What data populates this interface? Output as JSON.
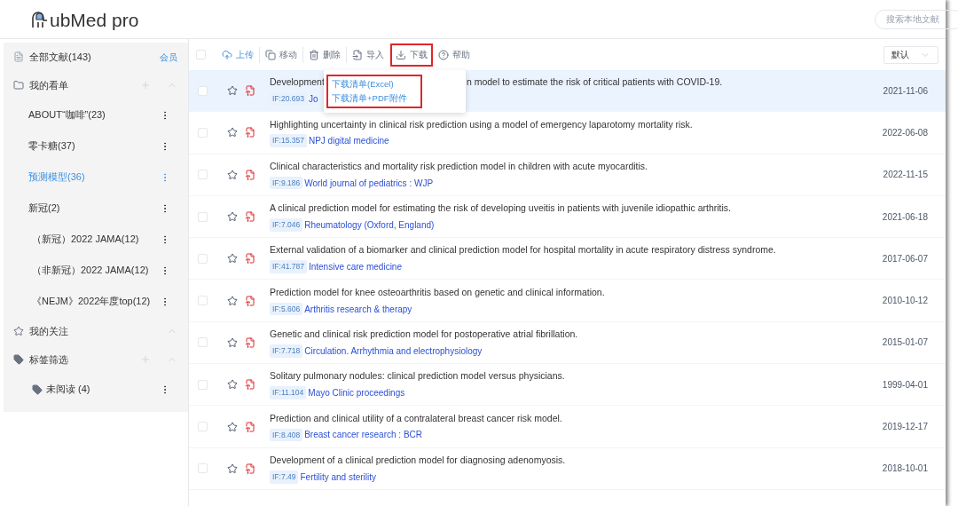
{
  "header": {
    "logo": "ubMed pro",
    "search": {
      "placeholder": "搜索本地文献"
    }
  },
  "sidebar": [
    {
      "kind": "all",
      "label": "全部文献(143)",
      "badge": "会员"
    },
    {
      "kind": "folder",
      "label": "我的看单",
      "add": true,
      "expanded": true,
      "children": [
        {
          "label": "ABOUT“咖啡”(23)",
          "selected": false
        },
        {
          "label": "零卡糖(37)",
          "selected": false
        },
        {
          "label": "预测模型(36)",
          "selected": true
        },
        {
          "label": "新冠(2)",
          "selected": false,
          "children": [
            {
              "label": "（新冠）2022 JAMA(12)",
              "selected": false
            },
            {
              "label": "（非新冠）2022 JAMA(12)",
              "selected": false
            },
            {
              "label": "《NEJM》2022年度top(12)",
              "selected": false
            }
          ]
        }
      ]
    },
    {
      "kind": "star",
      "label": "我的关注",
      "add": false,
      "expanded": true
    },
    {
      "kind": "tag",
      "label": "标签筛选",
      "add": true,
      "expanded": true,
      "children": [
        {
          "label": "未阅读 (4)",
          "selected": false,
          "kind": "tag"
        }
      ]
    }
  ],
  "toolbar": {
    "select_all": {
      "checked": false
    },
    "items": [
      {
        "kind": "upload",
        "label": "上传",
        "highlighted": false
      },
      {
        "kind": "move",
        "label": "移动",
        "highlighted": false
      },
      {
        "kind": "delete",
        "label": "删除",
        "highlighted": false
      },
      {
        "kind": "import",
        "label": "导入",
        "highlighted": false
      },
      {
        "kind": "download",
        "label": "下载",
        "highlighted": true
      },
      {
        "kind": "help",
        "label": "帮助",
        "highlighted": false
      }
    ],
    "sort": "默认"
  },
  "download_menu": {
    "highlighted": true,
    "items": [
      "下载清单(Excel)",
      "下载清单+PDF附件"
    ]
  },
  "articles": [
    {
      "title_parts": [
        "Development",
        "n model to estimate the risk of critical patients with COVID-19."
      ],
      "if": "IF:20.693",
      "journal": "Jo",
      "date": "2021-11-06",
      "selected": true,
      "checked": false
    },
    {
      "title_parts": [
        "Highlighting uncertainty in clinical risk prediction using a model of emergency laparotomy mortality risk."
      ],
      "if": "IF:15.357",
      "journal": "NPJ digital medicine",
      "date": "2022-06-08",
      "selected": false,
      "checked": false
    },
    {
      "title_parts": [
        "Clinical characteristics and mortality risk prediction model in children with acute myocarditis."
      ],
      "if": "IF:9.186",
      "journal": "World journal of pediatrics : WJP",
      "date": "2022-11-15",
      "selected": false,
      "checked": false
    },
    {
      "title_parts": [
        "A clinical prediction model for estimating the risk of developing uveitis in patients with juvenile idiopathic arthritis."
      ],
      "if": "IF:7.046",
      "journal": "Rheumatology (Oxford, England)",
      "date": "2021-06-18",
      "selected": false,
      "checked": false
    },
    {
      "title_parts": [
        "External validation of a biomarker and clinical prediction model for hospital mortality in acute respiratory distress syndrome."
      ],
      "if": "IF:41.787",
      "journal": "Intensive care medicine",
      "date": "2017-06-07",
      "selected": false,
      "checked": false
    },
    {
      "title_parts": [
        "Prediction model for knee osteoarthritis based on genetic and clinical information."
      ],
      "if": "IF:5.606",
      "journal": "Arthritis research & therapy",
      "date": "2010-10-12",
      "selected": false,
      "checked": false
    },
    {
      "title_parts": [
        "Genetic and clinical risk prediction model for postoperative atrial fibrillation."
      ],
      "if": "IF:7.718",
      "journal": "Circulation. Arrhythmia and electrophysiology",
      "date": "2015-01-07",
      "selected": false,
      "checked": false
    },
    {
      "title_parts": [
        "Solitary pulmonary nodules: clinical prediction model versus physicians."
      ],
      "if": "IF:11.104",
      "journal": "Mayo Clinic proceedings",
      "date": "1999-04-01",
      "selected": false,
      "checked": false
    },
    {
      "title_parts": [
        "Prediction and clinical utility of a contralateral breast cancer risk model."
      ],
      "if": "IF:8.408",
      "journal": "Breast cancer research : BCR",
      "date": "2019-12-17",
      "selected": false,
      "checked": false
    },
    {
      "title_parts": [
        "Development of a clinical prediction model for diagnosing adenomyosis."
      ],
      "if": "IF:7.49",
      "journal": "Fertility and sterility",
      "date": "2018-10-01",
      "selected": false,
      "checked": false
    }
  ]
}
